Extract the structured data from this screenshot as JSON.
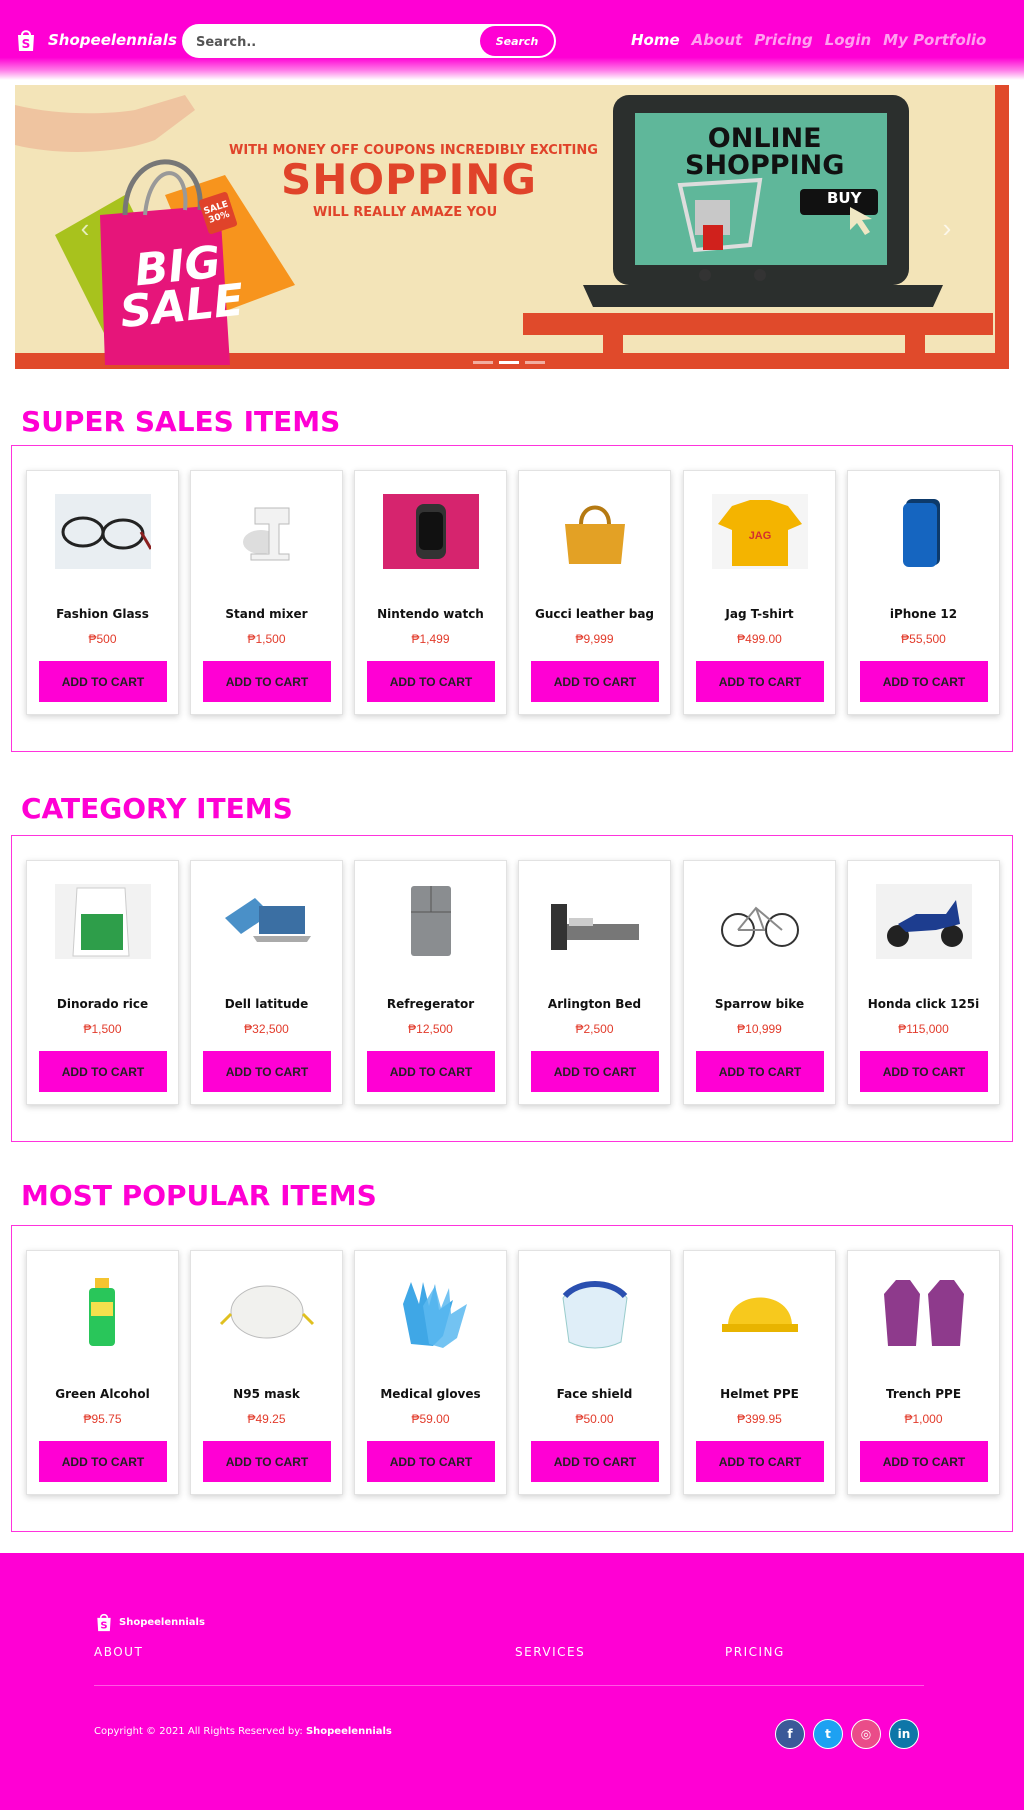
{
  "nav": {
    "brand": "Shopeelennials",
    "search_placeholder": "Search..",
    "search_button": "Search",
    "links": [
      "Home",
      "About",
      "Pricing",
      "Login",
      "My Portfolio"
    ],
    "active": "Home"
  },
  "banner": {
    "line1": "WITH MONEY OFF COUPONS INCREDIBLY EXCITING",
    "line2": "SHOPPING",
    "line3": "WILL REALLY AMAZE YOU",
    "big_sale_1": "BIG",
    "big_sale_2": "SALE",
    "tag_1": "SALE",
    "tag_2": "30%",
    "online_1": "ONLINE",
    "online_2": "SHOPPING",
    "buy": "BUY",
    "slide_count": 3,
    "active_slide": 2
  },
  "sections": [
    {
      "title": "SUPER SALES ITEMS",
      "items": [
        {
          "name": "Fashion Glass",
          "price": "₱500",
          "button": "ADD TO CART",
          "icon": "glasses-icon"
        },
        {
          "name": "Stand mixer",
          "price": "₱1,500",
          "button": "ADD TO CART",
          "icon": "mixer-icon"
        },
        {
          "name": "Nintendo watch",
          "price": "₱1,499",
          "button": "ADD TO CART",
          "icon": "watch-icon"
        },
        {
          "name": "Gucci leather bag",
          "price": "₱9,999",
          "button": "ADD TO CART",
          "icon": "bag-icon"
        },
        {
          "name": "Jag T-shirt",
          "price": "₱499.00",
          "button": "ADD TO CART",
          "icon": "tshirt-icon"
        },
        {
          "name": "iPhone 12",
          "price": "₱55,500",
          "button": "ADD TO CART",
          "icon": "phone-icon"
        }
      ]
    },
    {
      "title": "CATEGORY ITEMS",
      "items": [
        {
          "name": "Dinorado rice",
          "price": "₱1,500",
          "button": "ADD TO CART",
          "icon": "rice-sack-icon"
        },
        {
          "name": "Dell latitude",
          "price": "₱32,500",
          "button": "ADD TO CART",
          "icon": "laptop-icon"
        },
        {
          "name": "Refregerator",
          "price": "₱12,500",
          "button": "ADD TO CART",
          "icon": "refrigerator-icon"
        },
        {
          "name": "Arlington Bed",
          "price": "₱2,500",
          "button": "ADD TO CART",
          "icon": "bed-icon"
        },
        {
          "name": "Sparrow bike",
          "price": "₱10,999",
          "button": "ADD TO CART",
          "icon": "bicycle-icon"
        },
        {
          "name": "Honda click 125i",
          "price": "₱115,000",
          "button": "ADD TO CART",
          "icon": "scooter-icon"
        }
      ]
    },
    {
      "title": "MOST POPULAR ITEMS",
      "items": [
        {
          "name": "Green Alcohol",
          "price": "₱95.75",
          "button": "ADD TO CART",
          "icon": "alcohol-bottle-icon"
        },
        {
          "name": "N95 mask",
          "price": "₱49.25",
          "button": "ADD TO CART",
          "icon": "mask-icon"
        },
        {
          "name": "Medical gloves",
          "price": "₱59.00",
          "button": "ADD TO CART",
          "icon": "gloves-icon"
        },
        {
          "name": "Face shield",
          "price": "₱50.00",
          "button": "ADD TO CART",
          "icon": "face-shield-icon"
        },
        {
          "name": "Helmet PPE",
          "price": "₱399.95",
          "button": "ADD TO CART",
          "icon": "helmet-icon"
        },
        {
          "name": "Trench PPE",
          "price": "₱1,000",
          "button": "ADD TO CART",
          "icon": "gown-icon"
        }
      ]
    }
  ],
  "footer": {
    "brand": "Shopeelennials",
    "links": [
      "ABOUT",
      "SERVICES",
      "PRICING"
    ],
    "copyright_prefix": "Copyright © 2021 All Rights Reserved by: ",
    "copyright_brand": "Shopeelennials",
    "socials": [
      {
        "label": "f",
        "icon": "facebook-icon",
        "color": "#3b5998"
      },
      {
        "label": "t",
        "icon": "twitter-icon",
        "color": "#1da1f2"
      },
      {
        "label": "◎",
        "icon": "dribbble-icon",
        "color": "#ea4c89"
      },
      {
        "label": "in",
        "icon": "linkedin-icon",
        "color": "#0e76a8"
      }
    ]
  },
  "colors": {
    "accent": "#ff00d4",
    "price": "#e23b2b",
    "banner_red": "#e0432a",
    "banner_bg": "#f3e4b8"
  }
}
